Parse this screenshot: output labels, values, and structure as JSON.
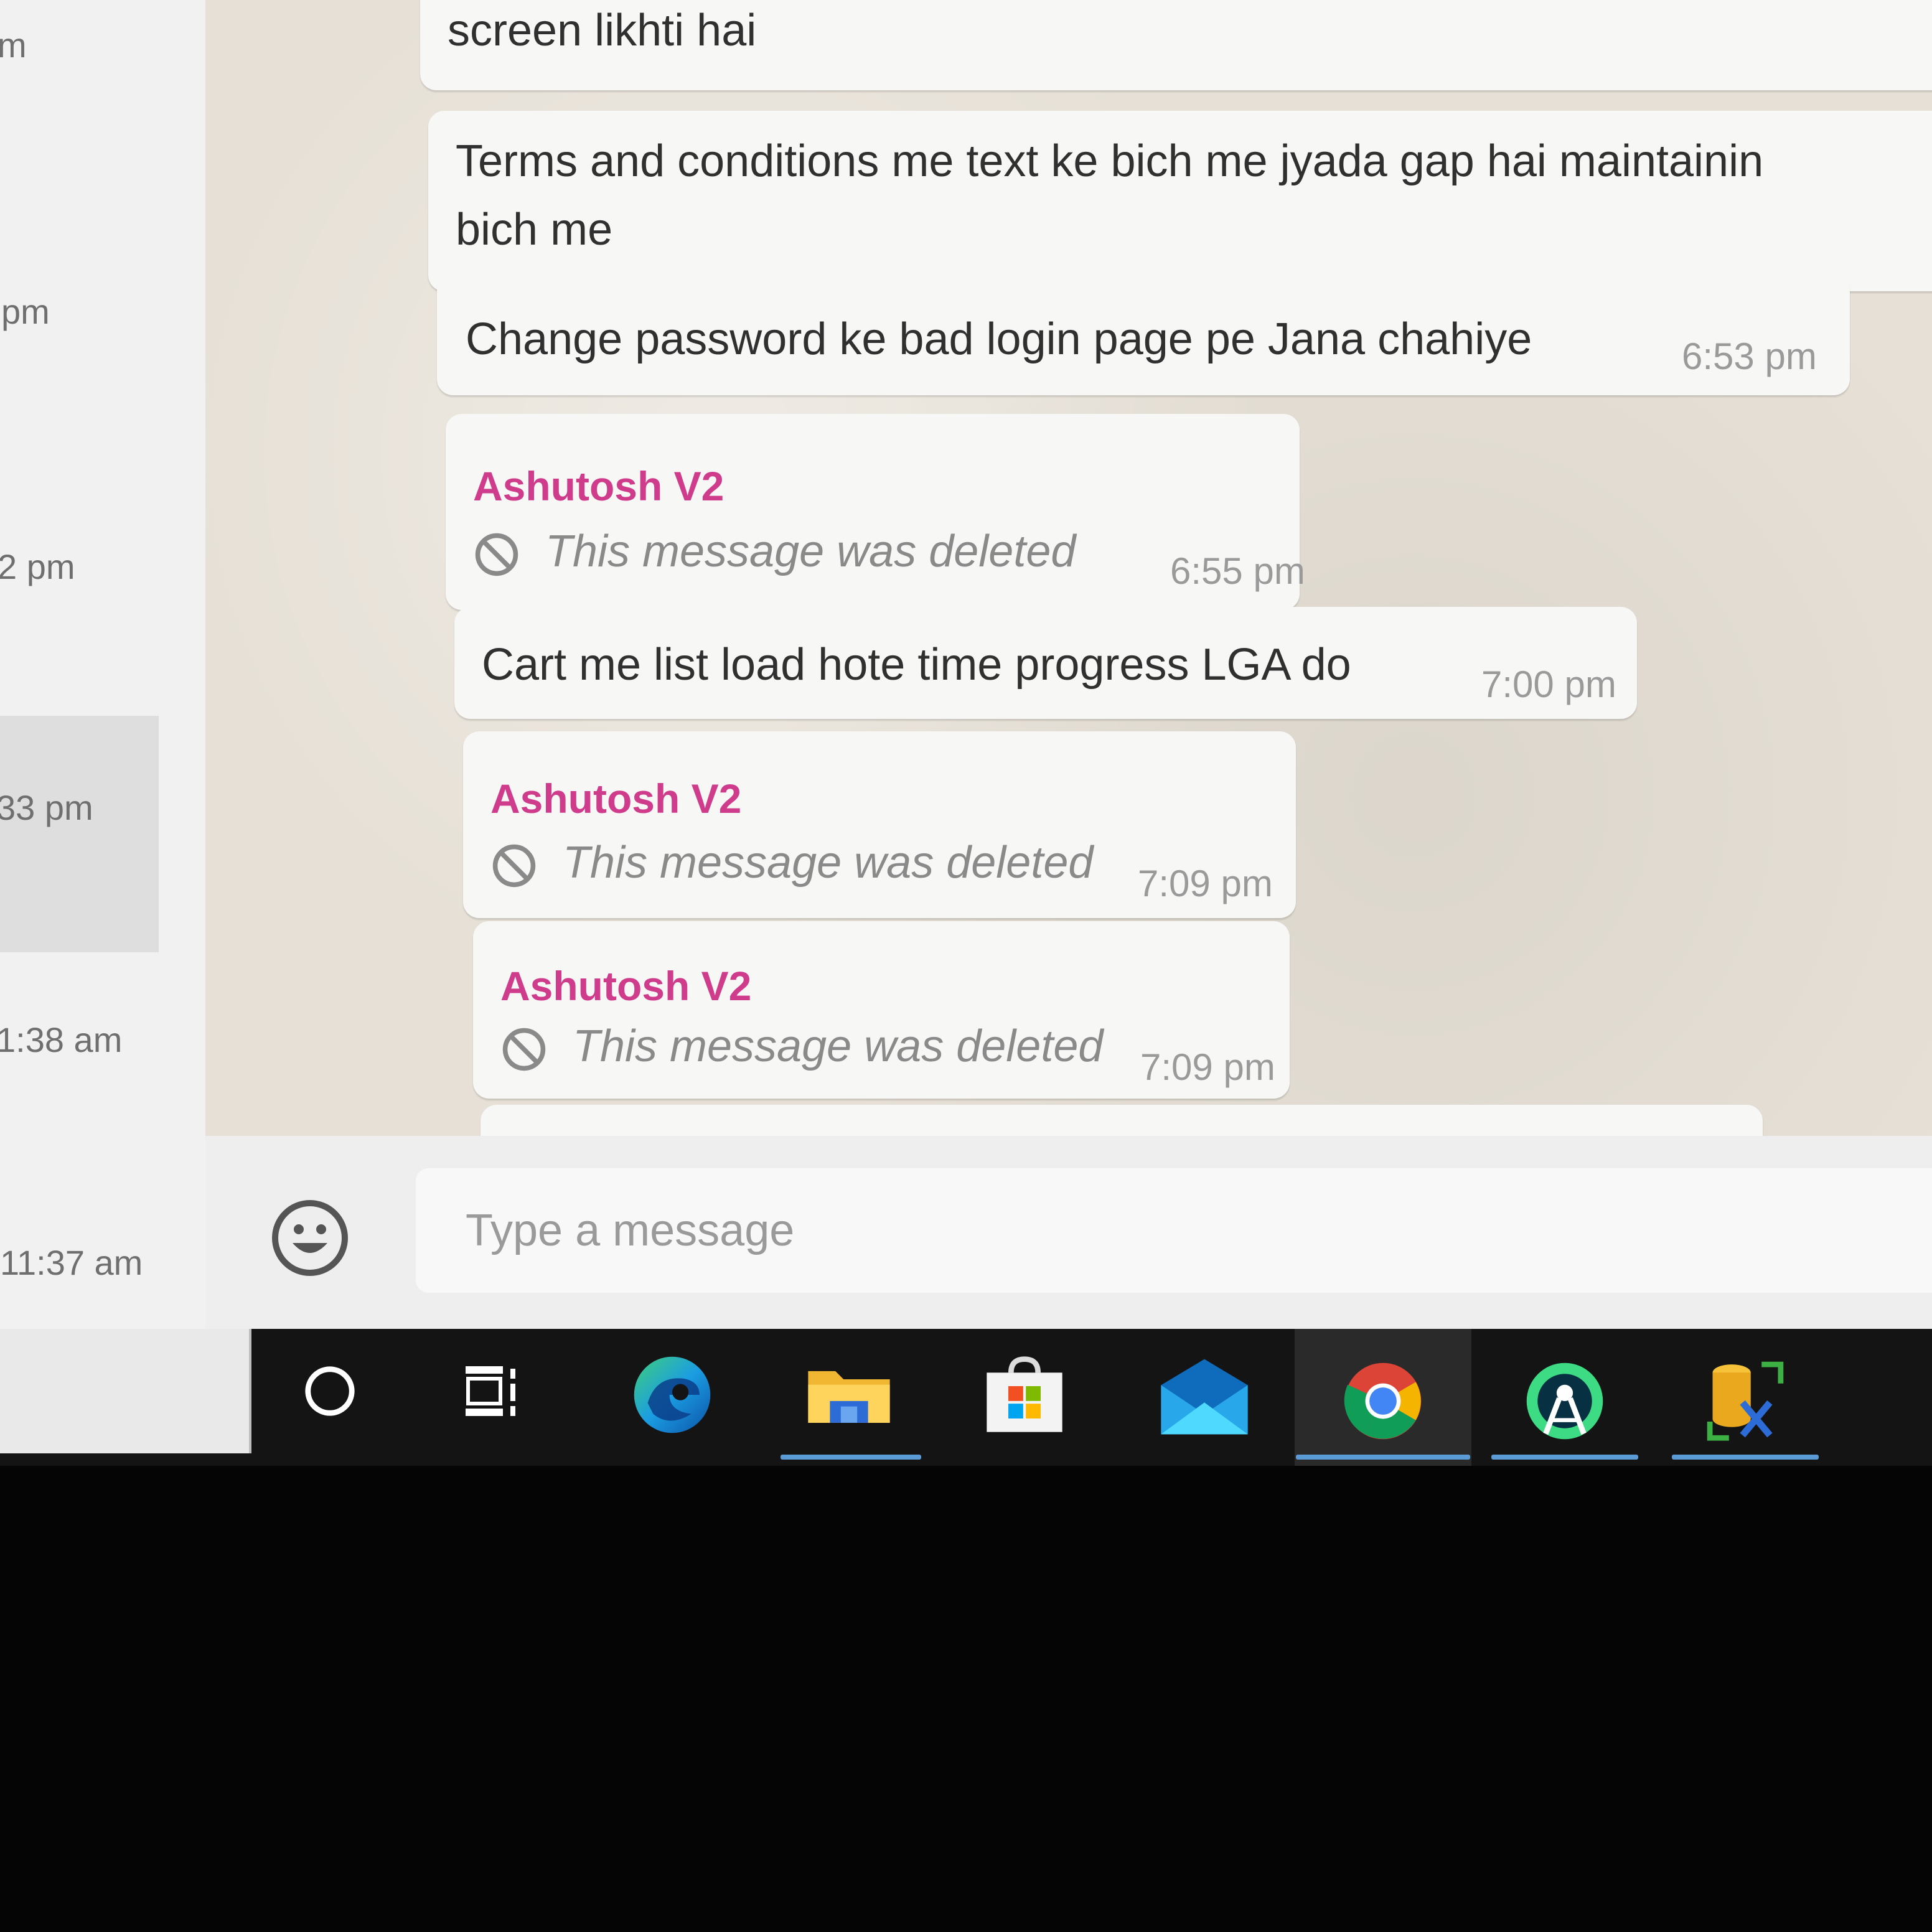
{
  "chat_list": {
    "times": [
      "m",
      "pm",
      "2 pm",
      "33 pm",
      "1:38 am",
      "11:37 am"
    ]
  },
  "messages": [
    {
      "type": "text",
      "text": "screen likhti hai"
    },
    {
      "type": "text",
      "line1": "Terms and conditions me text ke bich me jyada gap hai maintainin",
      "line2": "bich me"
    },
    {
      "type": "text",
      "text": "Change password ke bad login page pe Jana chahiye",
      "time": "6:53 pm"
    },
    {
      "type": "deleted",
      "sender": "Ashutosh V2",
      "text": "This message was deleted",
      "time": "6:55 pm"
    },
    {
      "type": "text",
      "text": "Cart me list load hote time progress LGA do",
      "time": "7:00 pm"
    },
    {
      "type": "deleted",
      "sender": "Ashutosh V2",
      "text": "This message was deleted",
      "time": "7:09 pm"
    },
    {
      "type": "deleted",
      "sender": "Ashutosh V2",
      "text": "This message was deleted",
      "time": "7:09 pm"
    }
  ],
  "compose": {
    "placeholder": "Type a message",
    "emoji_icon": "emoji-smiley-icon"
  },
  "taskbar": {
    "items": [
      {
        "name": "search-circle-icon",
        "active": false
      },
      {
        "name": "task-view-icon",
        "active": false
      },
      {
        "name": "edge-browser-icon",
        "active": false
      },
      {
        "name": "file-explorer-icon",
        "active": true
      },
      {
        "name": "microsoft-store-icon",
        "active": false
      },
      {
        "name": "mail-icon",
        "active": false
      },
      {
        "name": "chrome-icon",
        "active": true
      },
      {
        "name": "android-studio-icon",
        "active": true
      },
      {
        "name": "database-tool-icon",
        "active": true
      }
    ]
  },
  "colors": {
    "sender": "#d03c8c",
    "taskbar_underline": "#5b9bd5"
  }
}
